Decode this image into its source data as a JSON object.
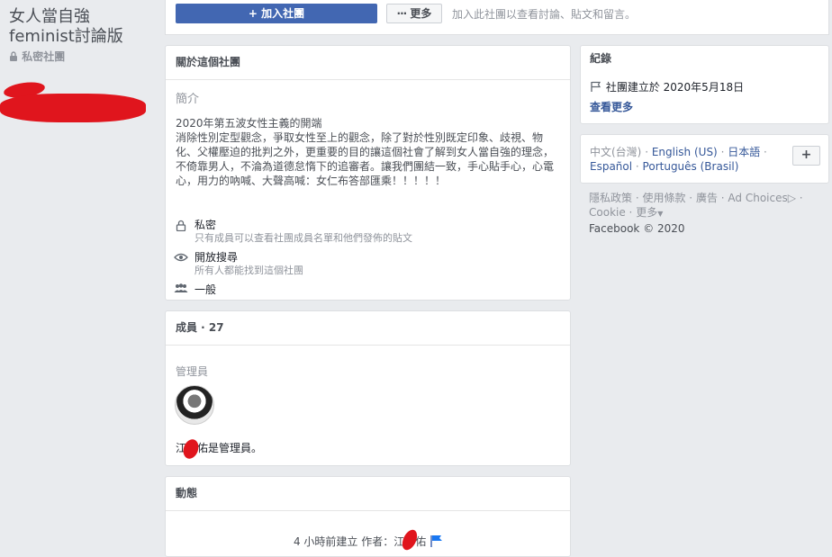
{
  "group": {
    "title_line1": "女人當自強",
    "title_line2": "feminist討論版",
    "privacy_badge": "私密社團"
  },
  "top_bar": {
    "join_button": "+ 加入社團",
    "more_button": "更多",
    "hint": "加入此社團以查看討論、貼文和留言。"
  },
  "about": {
    "header": "關於這個社團",
    "intro_label": "簡介",
    "description": "2020年第五波女性主義的開端\n消除性別定型觀念，爭取女性至上的觀念，除了對於性別既定印象、歧視、物化、父權壓迫的批判之外，更重要的目的讓這個社會了解到女人當自強的理念，不倚靠男人，不淪為道德怠惰下的追審者。讓我們團結一致，手心貼手心，心電心，用力的吶喊、大聲高喊：女仁布答部匯乘！！！！！",
    "items": [
      {
        "icon": "lock-icon",
        "title": "私密",
        "sub": "只有成員可以查看社團成員名單和他們發佈的貼文"
      },
      {
        "icon": "eye-icon",
        "title": "開放搜尋",
        "sub": "所有人都能找到這個社團"
      },
      {
        "icon": "group-icon",
        "title": "一般",
        "sub": ""
      }
    ]
  },
  "members": {
    "header": "成員 · 27",
    "admins_label": "管理員",
    "admin_text": "江　佑是管理員。"
  },
  "activity": {
    "header": "動態",
    "entry": "4 小時前建立 作者：江　佑"
  },
  "log": {
    "header": "紀錄",
    "created": "社團建立於 2020年5月18日",
    "see_more": "查看更多"
  },
  "languages": {
    "current": "中文(台灣)",
    "others": [
      "English (US)",
      "日本語",
      "Español",
      "Português (Brasil)"
    ],
    "add_button": "+"
  },
  "footer": {
    "links": [
      "隱私政策",
      "使用條款",
      "廣告",
      "Ad Choices",
      "Cookie",
      "更多"
    ],
    "copyright": "Facebook © 2020"
  },
  "colors": {
    "accent": "#4267b2",
    "link": "#365899",
    "background": "#e9ebee",
    "redaction": "#e0151d"
  }
}
